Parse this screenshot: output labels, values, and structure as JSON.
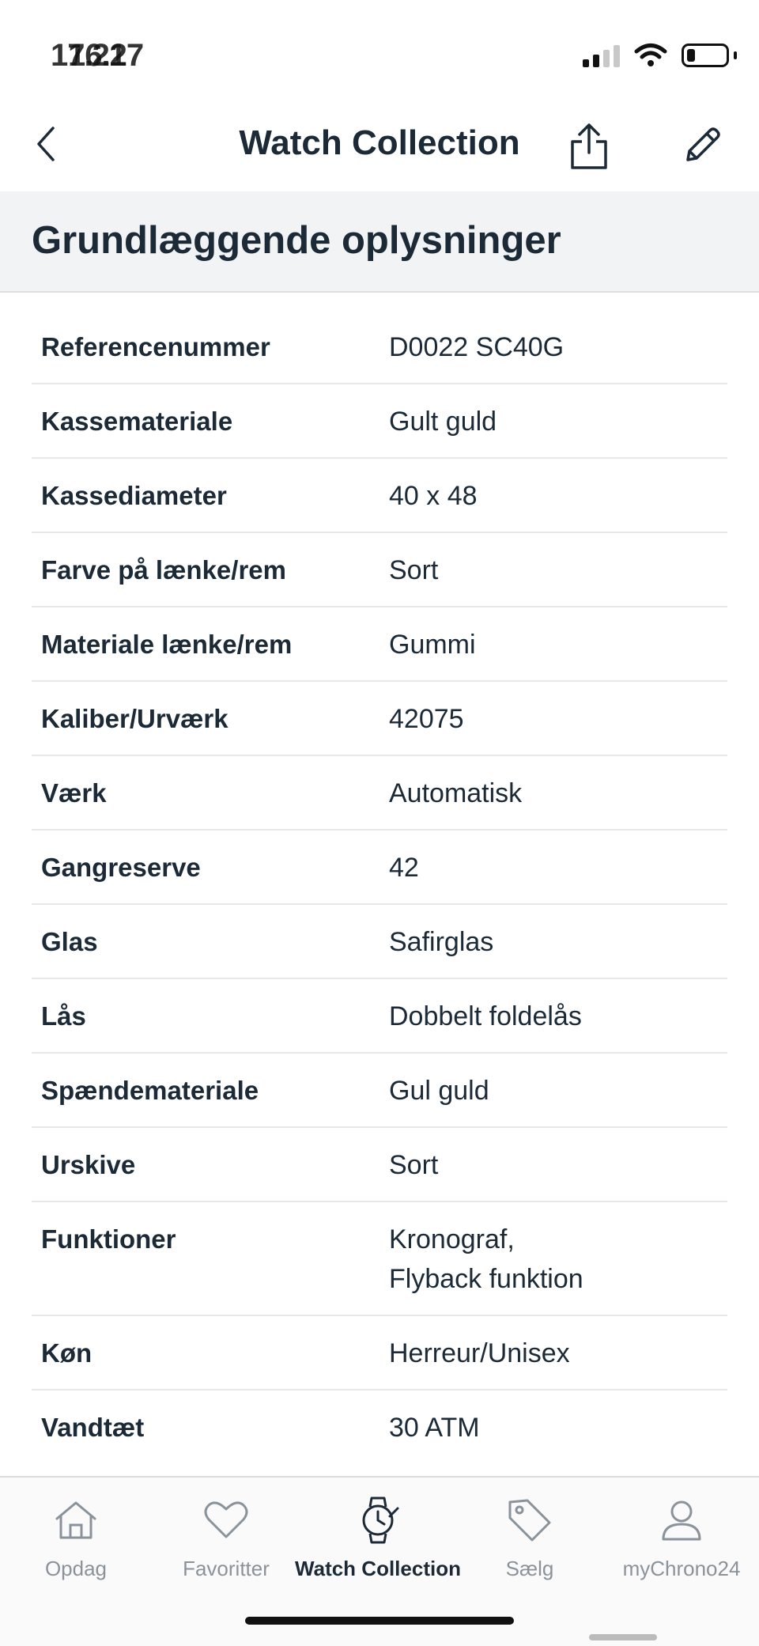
{
  "status_bar": {
    "time_back": "17.21",
    "time_front": "16.27"
  },
  "nav": {
    "title": "Watch Collection"
  },
  "section": {
    "title": "Grundlæggende oplysninger"
  },
  "details": [
    {
      "label": "Referencenummer",
      "value": "D0022 SC40G"
    },
    {
      "label": "Kassemateriale",
      "value": "Gult guld"
    },
    {
      "label": "Kassediameter",
      "value": "40 x 48"
    },
    {
      "label": "Farve på lænke/rem",
      "value": "Sort"
    },
    {
      "label": "Materiale lænke/rem",
      "value": "Gummi"
    },
    {
      "label": "Kaliber/Urværk",
      "value": "42075"
    },
    {
      "label": "Værk",
      "value": "Automatisk"
    },
    {
      "label": "Gangreserve",
      "value": "42"
    },
    {
      "label": "Glas",
      "value": "Safirglas"
    },
    {
      "label": "Lås",
      "value": "Dobbelt foldelås"
    },
    {
      "label": "Spændemateriale",
      "value": "Gul guld"
    },
    {
      "label": "Urskive",
      "value": "Sort"
    },
    {
      "label": "Funktioner",
      "value": "Kronograf,",
      "value2": "Flyback funktion"
    },
    {
      "label": "Køn",
      "value": "Herreur/Unisex"
    },
    {
      "label": "Vandtæt",
      "value": "30 ATM"
    }
  ],
  "tabs": [
    {
      "label": "Opdag",
      "icon": "home-icon",
      "active": false
    },
    {
      "label": "Favoritter",
      "icon": "heart-icon",
      "active": false
    },
    {
      "label": "Watch Collection",
      "icon": "watch-icon",
      "active": true
    },
    {
      "label": "Sælg",
      "icon": "tag-icon",
      "active": false
    },
    {
      "label": "myChrono24",
      "icon": "user-icon",
      "active": false
    }
  ],
  "colors": {
    "text": "#1b2a36",
    "inactive_tab": "#8a939b",
    "section_bg": "#f2f3f4"
  }
}
